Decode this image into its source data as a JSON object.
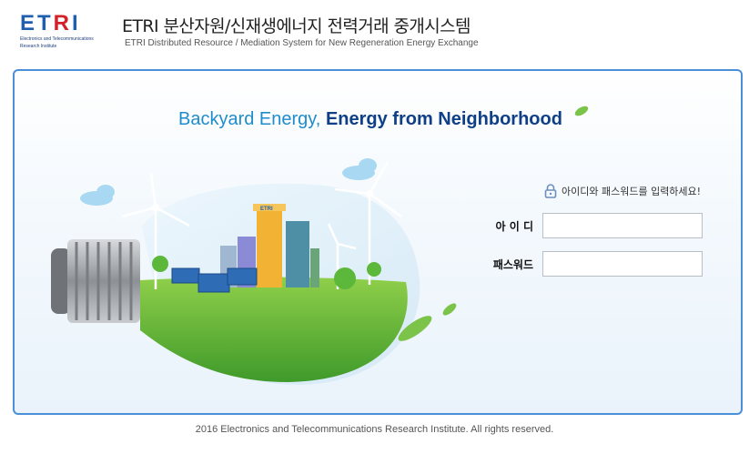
{
  "header": {
    "logo_text_prefix": "ET",
    "logo_text_r": "R",
    "logo_text_suffix": "I",
    "logo_subtitle_line1": "Electronics and Telecommunications",
    "logo_subtitle_line2": "Research Institute",
    "title": "ETRI 분산자원/신재생에너지 전력거래 중개시스템",
    "subtitle": "ETRI Distributed  Resource / Mediation System for New Regeneration Energy Exchange"
  },
  "hero": {
    "slogan_light": "Backyard Energy, ",
    "slogan_bold": "Energy from Neighborhood",
    "building_sign": "ETRI"
  },
  "login": {
    "notice": "아이디와 패스워드를 입력하세요!",
    "id_label": "아 이 디",
    "id_value": "",
    "password_label": "패스워드",
    "password_value": ""
  },
  "footer": {
    "copyright": "2016 Electronics and Telecommunications Research Institute. All rights reserved."
  },
  "colors": {
    "accent_blue": "#4a90d9",
    "slogan_light": "#1f8ccc",
    "slogan_dark": "#0f3f86",
    "logo_red": "#d2232a"
  }
}
